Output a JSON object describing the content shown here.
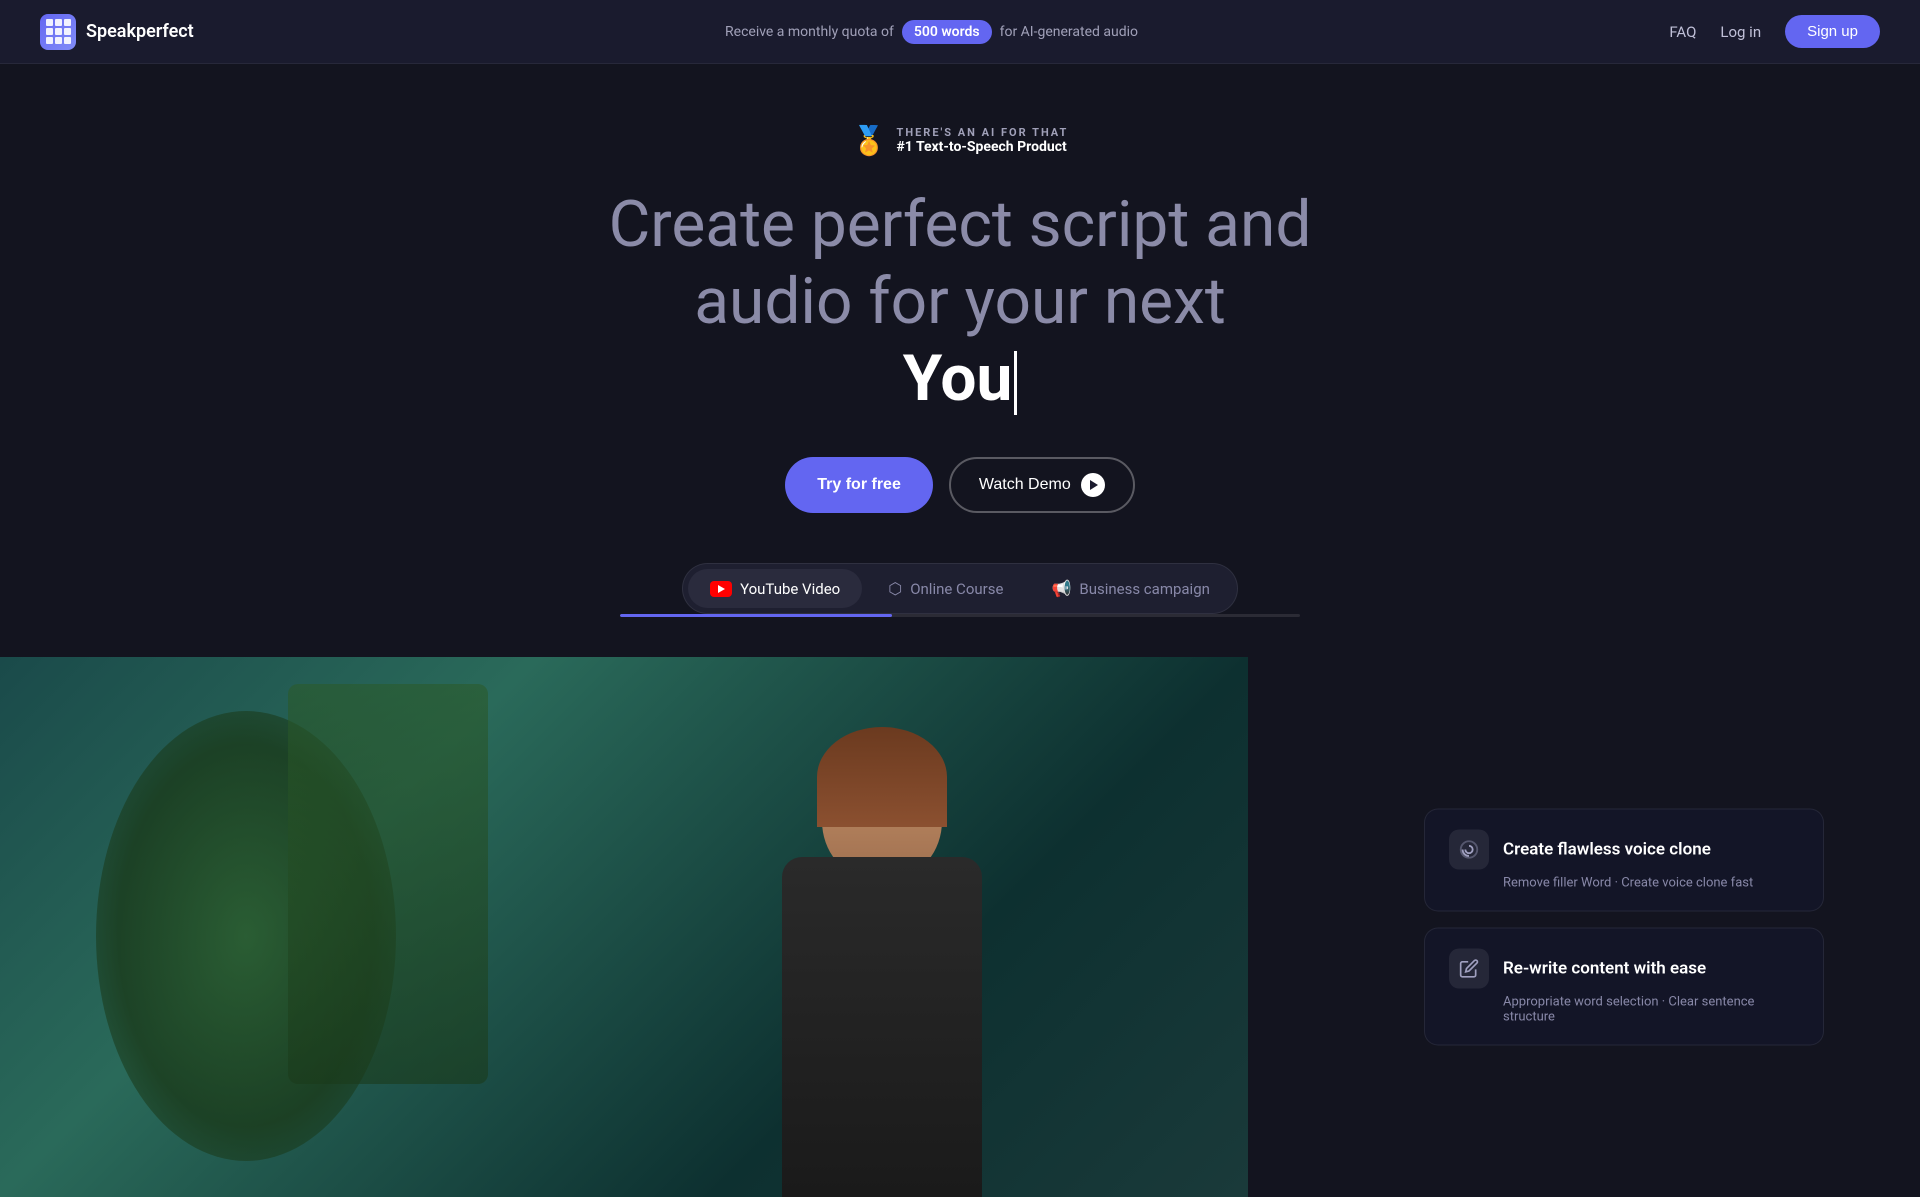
{
  "nav": {
    "logo_text": "Speakperfect",
    "quota_prefix": "Receive a monthly quota of",
    "quota_amount": "500 words",
    "quota_suffix": "for AI-generated audio",
    "faq_label": "FAQ",
    "login_label": "Log in",
    "signup_label": "Sign up"
  },
  "hero": {
    "award_subtitle": "THERE'S AN AI FOR THAT",
    "award_title": "#1 Text-to-Speech Product",
    "heading_line1": "Create perfect script and",
    "heading_line2": "audio for your next",
    "heading_typed": "You",
    "cta_try": "Try for free",
    "cta_demo": "Watch Demo"
  },
  "tabs": {
    "tab1_label": "YouTube Video",
    "tab2_label": "Online Course",
    "tab3_label": "Business campaign"
  },
  "features": {
    "card1_title": "Create flawless voice clone",
    "card1_desc": "Remove filler Word · Create voice clone fast",
    "card2_title": "Re-write content with ease",
    "card2_desc": "Appropriate word selection · Clear sentence structure"
  }
}
